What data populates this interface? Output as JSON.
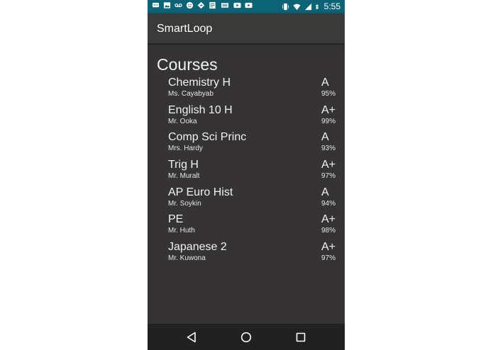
{
  "status_bar": {
    "time": "5:55",
    "icons_left": [
      "chat-icon",
      "image-icon",
      "voicemail-icon",
      "emoji-icon",
      "navigation-icon",
      "document-icon",
      "news-icon",
      "youtube-icon",
      "youtube-icon"
    ],
    "icons_right": [
      "vibrate-icon",
      "wifi-icon",
      "signal-icon",
      "battery-charging-icon"
    ]
  },
  "app_bar": {
    "title": "SmartLoop"
  },
  "courses": {
    "heading": "Courses",
    "items": [
      {
        "name": "Chemistry H",
        "teacher": "Ms. Cayabyab",
        "grade": "A",
        "percent": "95%"
      },
      {
        "name": "English 10 H",
        "teacher": "Mr. Ooka",
        "grade": "A+",
        "percent": "99%"
      },
      {
        "name": "Comp Sci Princ",
        "teacher": "Mrs. Hardy",
        "grade": "A",
        "percent": "93%"
      },
      {
        "name": "Trig H",
        "teacher": "Mr. Muralt",
        "grade": "A+",
        "percent": "97%"
      },
      {
        "name": "AP Euro Hist",
        "teacher": "Mr. Soykin",
        "grade": "A",
        "percent": "94%"
      },
      {
        "name": "PE",
        "teacher": "Mr. Huth",
        "grade": "A+",
        "percent": "98%"
      },
      {
        "name": "Japanese 2",
        "teacher": "Mr. Kuwona",
        "grade": "A+",
        "percent": "97%"
      }
    ]
  },
  "nav_bar": {
    "buttons": [
      "back-icon",
      "home-icon",
      "recents-icon"
    ]
  },
  "colors": {
    "status_bar": "#0c6376",
    "app_bar": "#3a3a3a",
    "background": "#353333",
    "nav_bar": "#212121",
    "text": "#f2f2f2"
  }
}
